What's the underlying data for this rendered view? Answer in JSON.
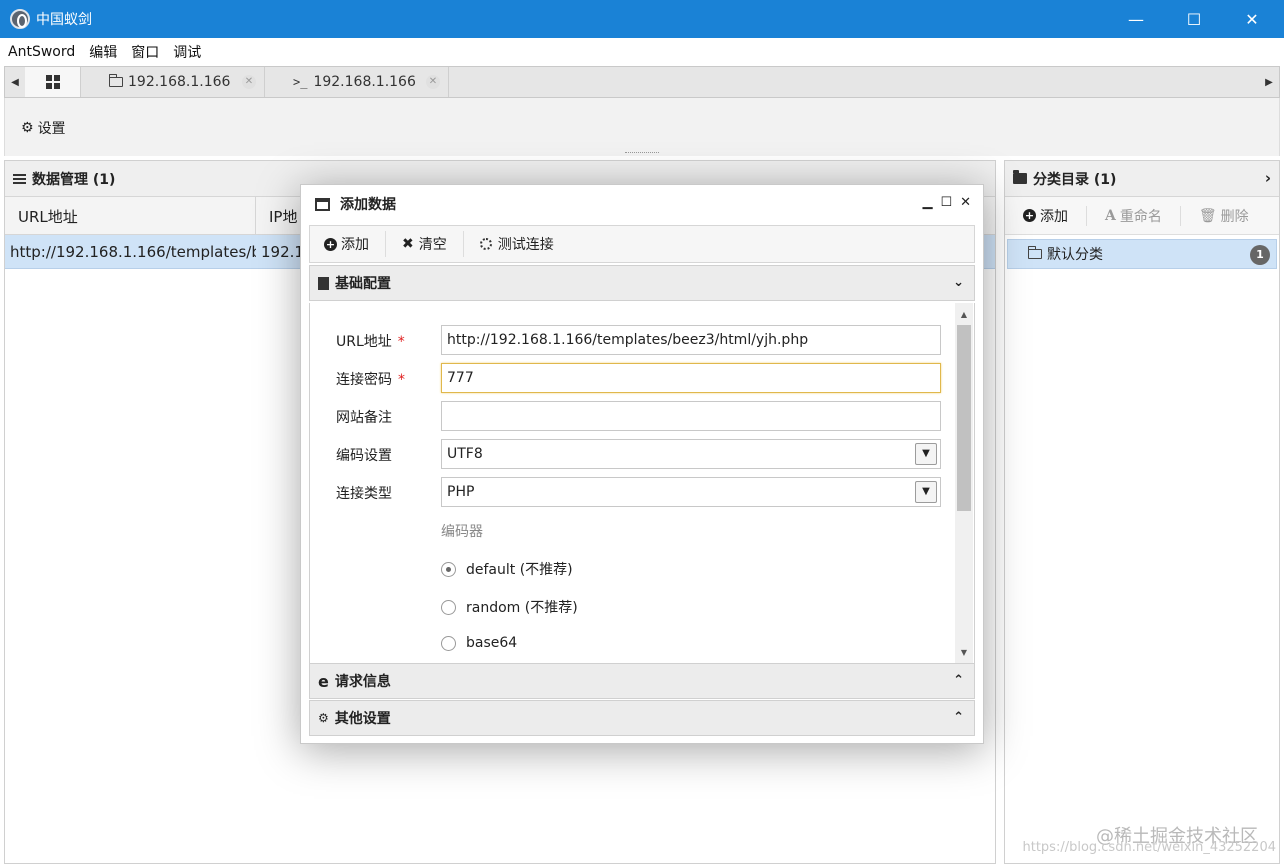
{
  "window": {
    "title": "中国蚁剑",
    "minimize": "—",
    "maximize": "☐",
    "close": "✕"
  },
  "menu": [
    "AntSword",
    "编辑",
    "窗口",
    "调试"
  ],
  "tabs": {
    "left_arrow": "◀",
    "right_arrow": "▶",
    "items": [
      {
        "label": "192.168.1.166",
        "close": "✕"
      },
      {
        "label": "192.168.1.166",
        "close": "✕",
        "prefix": ">_"
      }
    ]
  },
  "toolbar": {
    "settings": "设置"
  },
  "data_panel": {
    "title": "数据管理 (1)",
    "columns": [
      "URL地址",
      "IP地"
    ],
    "rows": [
      {
        "url": "http://192.168.1.166/templates/beez3/html/yjh.php",
        "ip": "192.1"
      }
    ]
  },
  "category_panel": {
    "title": "分类目录 (1)",
    "chevron": "›",
    "add": "添加",
    "rename": "重命名",
    "delete": "删除",
    "items": [
      {
        "label": "默认分类",
        "count": "1"
      }
    ]
  },
  "modal": {
    "title": "添加数据",
    "controls": {
      "minimize": "▁",
      "maximize": "☐",
      "close": "✕"
    },
    "toolbar": {
      "add": "添加",
      "clear": "清空",
      "test": "测试连接"
    },
    "sections": {
      "basic": "基础配置",
      "request": "请求信息",
      "other": "其他设置"
    },
    "form": {
      "url_label": "URL地址",
      "url_value": "http://192.168.1.166/templates/beez3/html/yjh.php",
      "password_label": "连接密码",
      "password_value": "777",
      "note_label": "网站备注",
      "note_value": "",
      "encoding_label": "编码设置",
      "encoding_value": "UTF8",
      "type_label": "连接类型",
      "type_value": "PHP",
      "encoder_label": "编码器",
      "encoders": [
        {
          "label": "default (不推荐)",
          "checked": true
        },
        {
          "label": "random (不推荐)",
          "checked": false
        },
        {
          "label": "base64",
          "checked": false
        }
      ],
      "required_mark": "*"
    }
  },
  "watermark": {
    "main": "@稀土掘金技术社区",
    "sub": "https://blog.csdn.net/weixin_43252204"
  }
}
